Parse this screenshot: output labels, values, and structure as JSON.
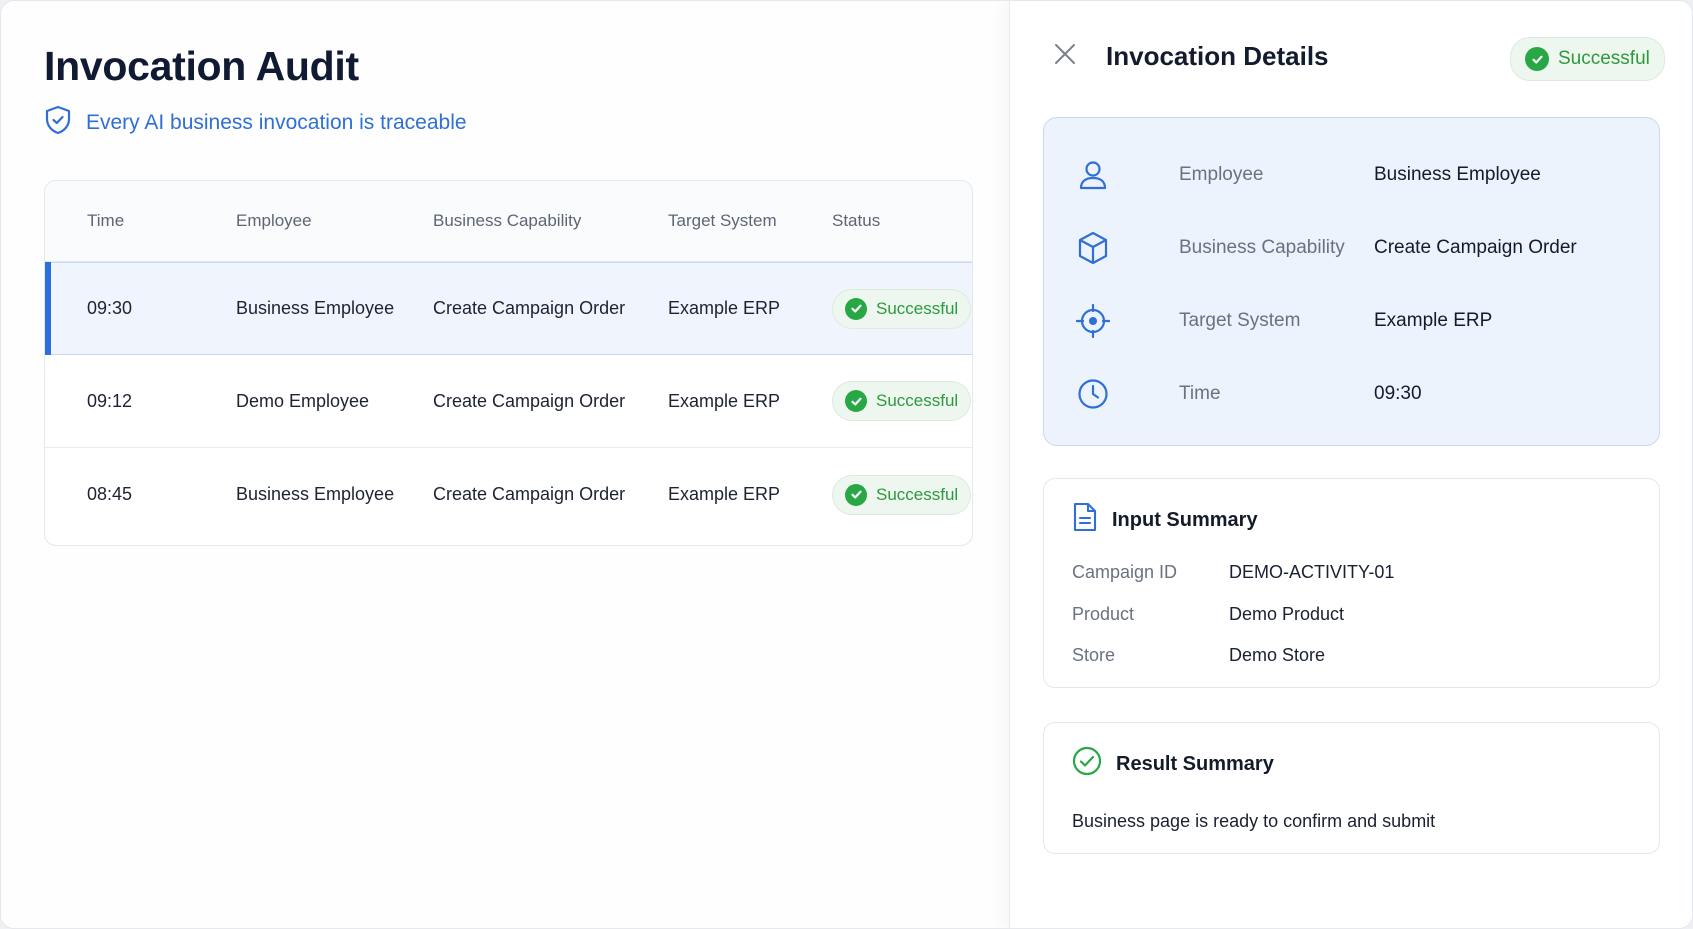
{
  "main": {
    "title": "Invocation Audit",
    "subtitle": "Every AI business invocation is traceable",
    "table": {
      "headers": {
        "time": "Time",
        "employee": "Employee",
        "capability": "Business Capability",
        "system": "Target System",
        "status": "Status"
      },
      "rows": [
        {
          "time": "09:30",
          "employee": "Business Employee",
          "capability": "Create Campaign Order",
          "system": "Example ERP",
          "status": "Successful",
          "selected": true
        },
        {
          "time": "09:12",
          "employee": "Demo Employee",
          "capability": "Create Campaign Order",
          "system": "Example ERP",
          "status": "Successful",
          "selected": false
        },
        {
          "time": "08:45",
          "employee": "Business Employee",
          "capability": "Create Campaign Order",
          "system": "Example ERP",
          "status": "Successful",
          "selected": false
        }
      ]
    }
  },
  "panel": {
    "title": "Invocation Details",
    "status": "Successful",
    "details": {
      "employee_label": "Employee",
      "employee_value": "Business Employee",
      "capability_label": "Business Capability",
      "capability_value": "Create Campaign Order",
      "system_label": "Target System",
      "system_value": "Example ERP",
      "time_label": "Time",
      "time_value": "09:30"
    },
    "input_summary": {
      "title": "Input Summary",
      "items": [
        {
          "key": "Campaign ID",
          "value": "DEMO-ACTIVITY-01"
        },
        {
          "key": "Product",
          "value": "Demo Product"
        },
        {
          "key": "Store",
          "value": "Demo Store"
        }
      ]
    },
    "result_summary": {
      "title": "Result Summary",
      "text": "Business page is ready to confirm and submit"
    }
  },
  "colors": {
    "accent": "#2f6fd6",
    "success": "#28a745",
    "selected_row_bg": "#f0f5fd",
    "detail_card_bg": "#edf3fc"
  },
  "icons": {
    "subtitle": "shield-check-icon",
    "close": "close-icon",
    "status": "check-circle-icon",
    "employee": "user-icon",
    "capability": "cube-icon",
    "system": "crosshair-icon",
    "time": "clock-icon",
    "input_summary": "document-icon",
    "result_summary": "check-circle-outline-icon"
  }
}
